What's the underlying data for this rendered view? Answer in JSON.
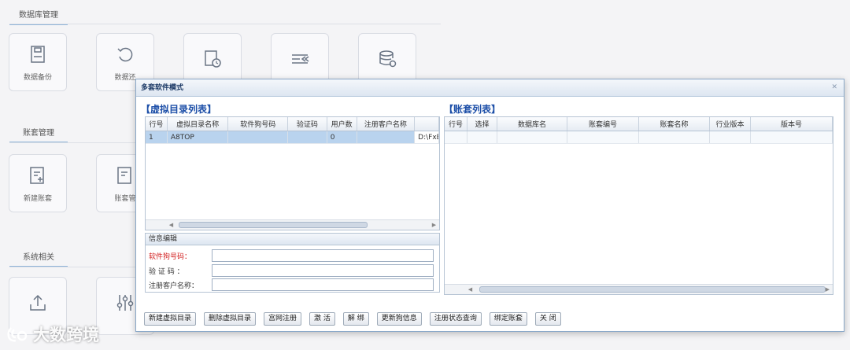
{
  "background": {
    "sections": [
      {
        "title": "数据库管理",
        "tiles": [
          {
            "label": "数据备份",
            "icon": "database-backup-icon"
          },
          {
            "label": "数据还",
            "icon": "restore-icon"
          },
          {
            "label": "",
            "icon": "database-schedule-icon"
          },
          {
            "label": "",
            "icon": "list-collapse-icon"
          },
          {
            "label": "",
            "icon": "database-settings-icon"
          }
        ]
      },
      {
        "title": "账套管理",
        "tiles": [
          {
            "label": "新建账套",
            "icon": "new-account-icon"
          },
          {
            "label": "账套管",
            "icon": "account-manage-icon"
          }
        ]
      },
      {
        "title": "系统相关",
        "tiles": [
          {
            "label": "",
            "icon": "upload-icon"
          },
          {
            "label": "",
            "icon": "sliders-icon"
          }
        ]
      }
    ],
    "watermark": "大数跨境"
  },
  "dialog": {
    "title": "多套软件模式",
    "close_icon": "close-icon",
    "virtual_list": {
      "title": "【虚拟目录列表】",
      "columns": [
        "行号",
        "虚拟目录名称",
        "软件狗号码",
        "验证码",
        "用户数",
        "注册客户名称",
        ""
      ],
      "rows": [
        {
          "cells": [
            "1",
            "A8TOP",
            "",
            "",
            "0",
            "",
            "D:\\FxE"
          ]
        }
      ]
    },
    "account_list": {
      "title": "【账套列表】",
      "columns": [
        "行号",
        "选择",
        "数据库名",
        "账套编号",
        "账套名称",
        "行业版本",
        "版本号"
      ]
    },
    "info_edit": {
      "title": "信息编辑",
      "fields": [
        {
          "label": "软件狗号码：",
          "value": "",
          "required": true
        },
        {
          "label": "验  证  码  ：",
          "value": "",
          "required": false
        },
        {
          "label": "注册客户名称：",
          "value": "",
          "required": false
        }
      ]
    },
    "buttons": [
      "新建虚拟目录",
      "删除虚拟目录",
      "宫网注册",
      "激 活",
      "解 绑",
      "更新狗信息",
      "注册状态查询",
      "绑定账套",
      "关 闭"
    ]
  }
}
